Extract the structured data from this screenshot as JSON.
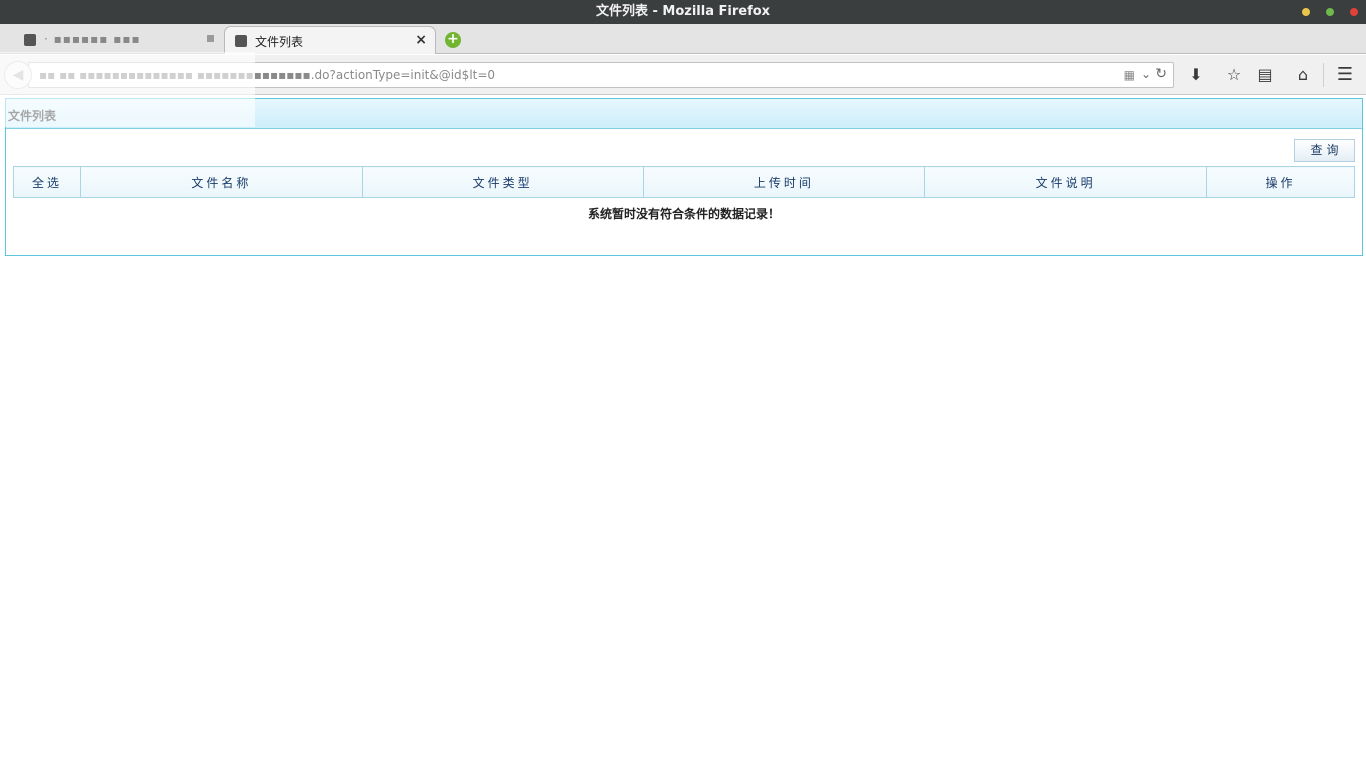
{
  "window": {
    "title": "文件列表 - Mozilla Firefox"
  },
  "tabs": [
    {
      "label": "· ▪▪▪▪▪▪ ▪▪▪",
      "active": false
    },
    {
      "label": "文件列表",
      "active": true
    }
  ],
  "navbar": {
    "url": "▪▪ ▪▪ ▪▪▪▪▪▪▪▪▪▪▪▪▪▪ ▪▪▪▪▪▪▪▪▪▪▪▪▪▪.do?actionType=init&@id$lt=0",
    "icons": [
      "back-icon",
      "qr-code-icon",
      "dropdown-icon",
      "reload-icon",
      "download-icon",
      "bookmark-star-icon",
      "reading-list-icon",
      "home-icon",
      "menu-icon"
    ]
  },
  "panel": {
    "title": "文件列表",
    "query_label": "查询"
  },
  "table": {
    "columns": [
      "全选",
      "文件名称",
      "文件类型",
      "上传时间",
      "文件说明",
      "操作"
    ],
    "empty_message": "系统暂时没有符合条件的数据记录！"
  },
  "colors": {
    "titlebar": "#3b3e3f",
    "panel_border": "#5ec6dc",
    "header_bg": "#cdeefb",
    "table_text": "#1a3c6b"
  }
}
